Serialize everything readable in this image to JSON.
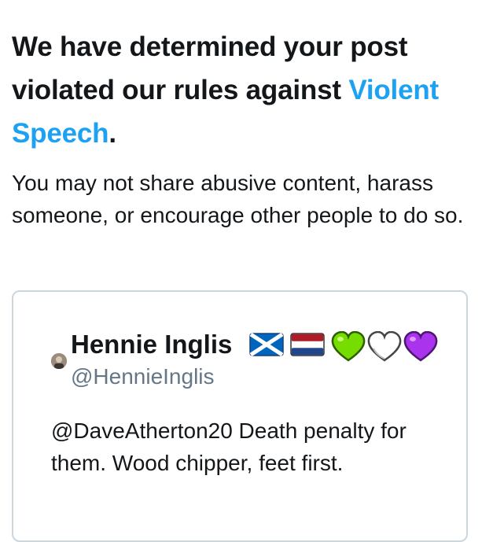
{
  "notice": {
    "headline_prefix": "We have determined your post violated our rules against ",
    "headline_link": "Violent Speech",
    "headline_suffix": ".",
    "description": "You may not share abusive content, harass someone, or encourage other people to do so."
  },
  "tweet": {
    "display_name": "Hennie Inglis",
    "username": "@HennieInglis",
    "text": "@DaveAtherton20 Death penalty for them. Wood chipper, feet first.",
    "name_emoji": [
      "scotland-flag-icon",
      "netherlands-flag-icon",
      "green-heart-icon",
      "white-heart-icon",
      "purple-heart-icon"
    ]
  },
  "colors": {
    "link": "#1da1f2",
    "text": "#14171a",
    "muted": "#657786",
    "border": "#ccd6dd",
    "green_heart": "#77dd00",
    "white_heart": "#ffffff",
    "purple_heart": "#aa33ee"
  }
}
